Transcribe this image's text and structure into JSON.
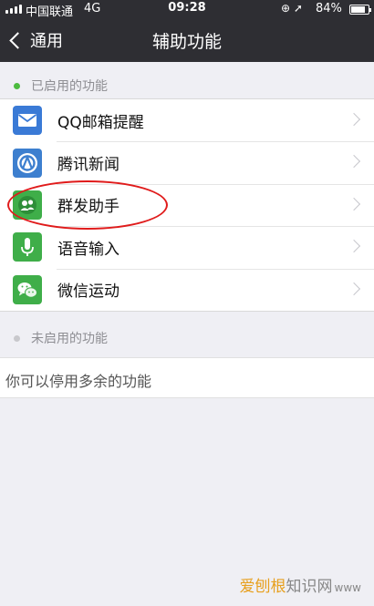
{
  "status": {
    "carrier": "中国联通",
    "network": "4G",
    "time": "09:28",
    "icons": "⊕ ➚",
    "battery_pct": "84%",
    "battery_level": 0.84,
    "signal_bars": 4
  },
  "nav": {
    "back_label": "通用",
    "title": "辅助功能"
  },
  "enabled": {
    "header": "已启用的功能",
    "dot_color": "#4cbb3f",
    "items": [
      {
        "label": "QQ邮箱提醒",
        "icon": "mail-icon"
      },
      {
        "label": "腾讯新闻",
        "icon": "news-icon"
      },
      {
        "label": "群发助手",
        "icon": "group-send-icon"
      },
      {
        "label": "语音输入",
        "icon": "microphone-icon"
      },
      {
        "label": "微信运动",
        "icon": "wechat-sport-icon"
      }
    ]
  },
  "disabled": {
    "header": "未启用的功能",
    "dot_color": "#c8c8cc",
    "hint": "你可以停用多余的功能"
  },
  "annotation_color": "#e01b1b",
  "watermark": {
    "part1": "爱刨根",
    "part2": "知识网",
    "part3": "www"
  }
}
